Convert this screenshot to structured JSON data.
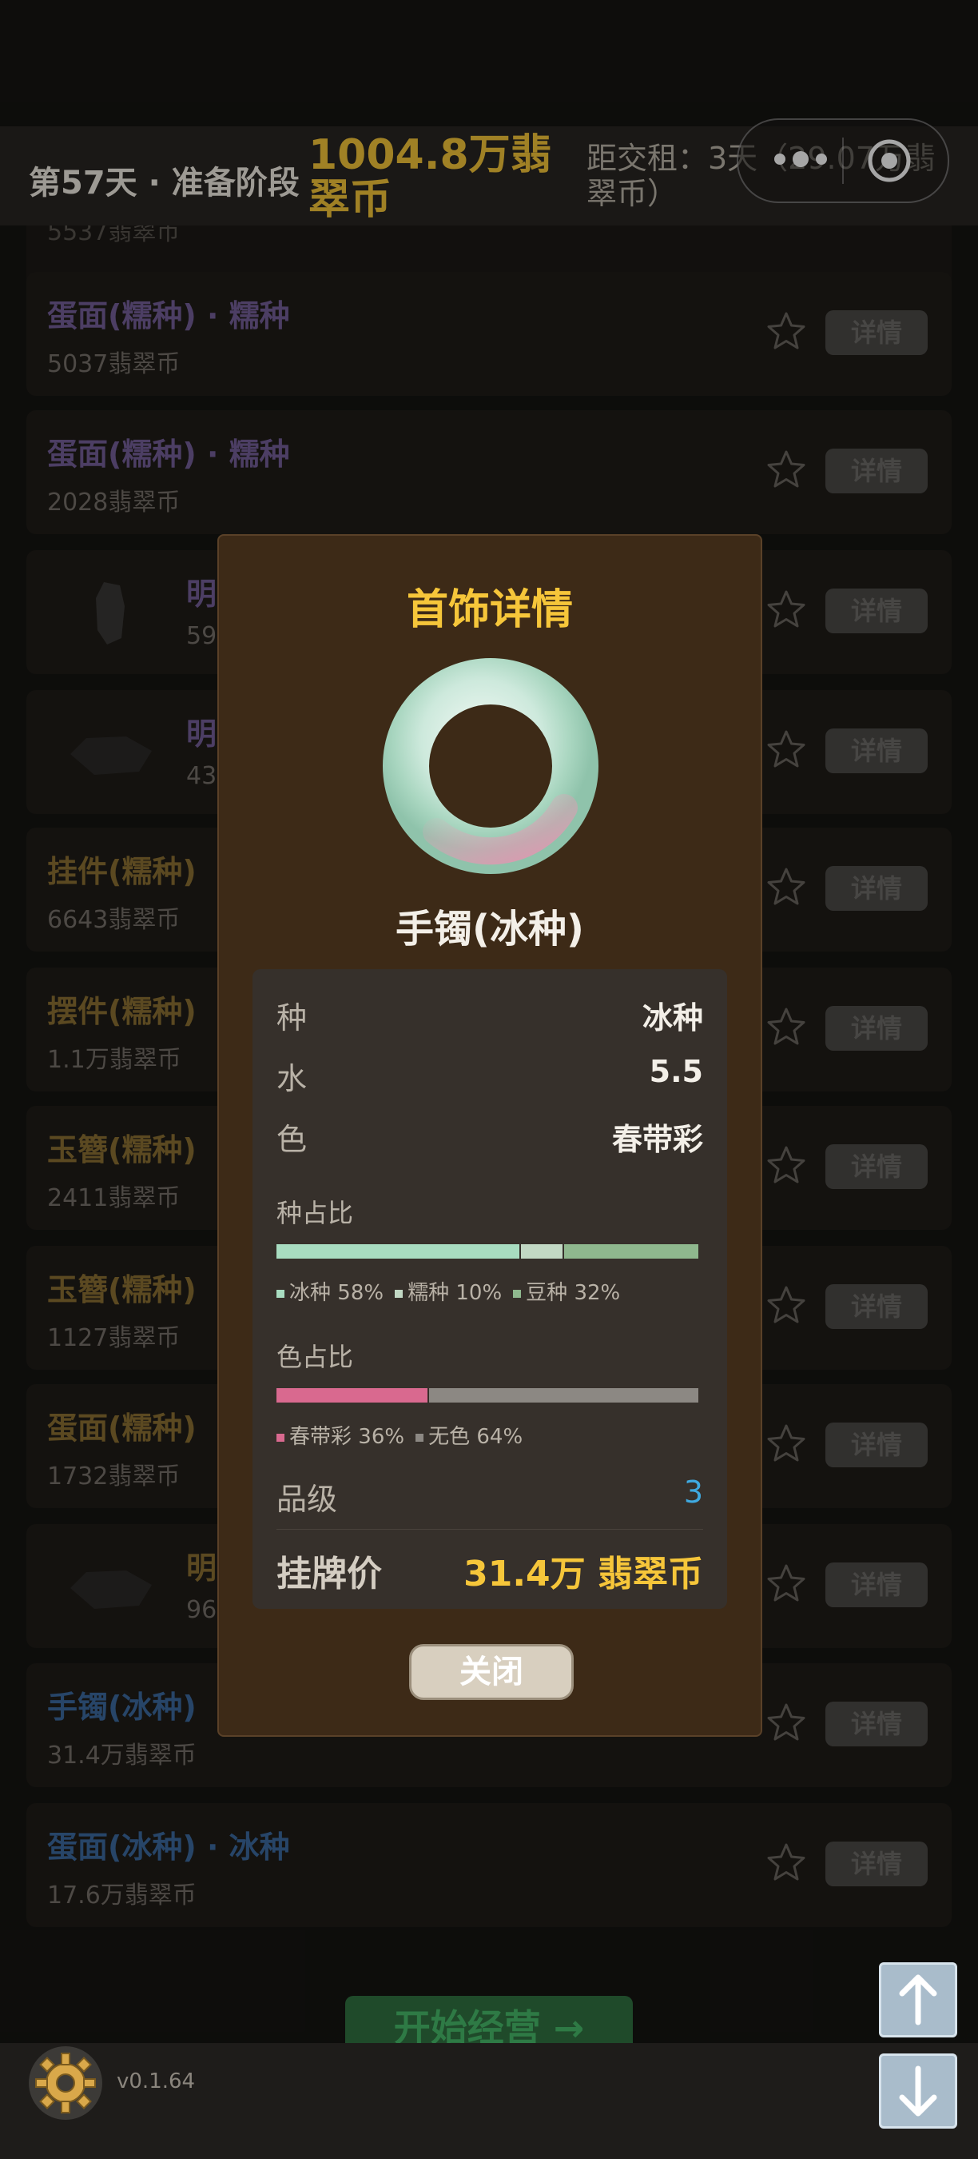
{
  "header": {
    "day_stage": "第57天 · 准备阶段",
    "money": "1004.8万翡翠币",
    "rent_info": "距交租：3天（29.07万翡翠币）"
  },
  "list": {
    "items": [
      {
        "name": "蛋面(糯种) · 糯种",
        "price": "5037翡翠币",
        "color": "purple",
        "detail_label": "详情"
      },
      {
        "name": "蛋面(糯种) · 糯种",
        "price": "2028翡翠币",
        "color": "purple",
        "detail_label": "详情"
      },
      {
        "name": "明",
        "price": "59",
        "color": "purple",
        "detail_label": "详情"
      },
      {
        "name": "明",
        "price": "43",
        "color": "purple",
        "detail_label": "详情"
      },
      {
        "name": "挂件(糯种)",
        "price": "6643翡翠币",
        "color": "gold",
        "detail_label": "详情"
      },
      {
        "name": "摆件(糯种)",
        "price": "1.1万翡翠币",
        "color": "gold",
        "detail_label": "详情"
      },
      {
        "name": "玉簪(糯种)",
        "price": "2411翡翠币",
        "color": "gold",
        "detail_label": "详情"
      },
      {
        "name": "玉簪(糯种)",
        "price": "1127翡翠币",
        "color": "gold",
        "detail_label": "详情"
      },
      {
        "name": "蛋面(糯种)",
        "price": "1732翡翠币",
        "color": "gold",
        "detail_label": "详情"
      },
      {
        "name": "明",
        "price": "96",
        "color": "gold",
        "detail_label": "详情"
      },
      {
        "name": "手镯(冰种)",
        "price": "31.4万翡翠币",
        "color": "blue",
        "detail_label": "详情"
      },
      {
        "name": "蛋面(冰种) · 冰种",
        "price": "17.6万翡翠币",
        "color": "blue",
        "detail_label": "详情"
      }
    ]
  },
  "modal": {
    "title": "首饰详情",
    "item_name": "手镯(冰种)",
    "rows": {
      "zhong_label": "种",
      "zhong_value": "冰种",
      "shui_label": "水",
      "shui_value": "5.5",
      "se_label": "色",
      "se_value": "春带彩"
    },
    "zhong_ratio": {
      "title": "种占比",
      "segments": [
        {
          "name": "冰种",
          "percent": 58,
          "label": "58%",
          "color": "#a8dcc0"
        },
        {
          "name": "糯种",
          "percent": 10,
          "label": "10%",
          "color": "#c2d8c4"
        },
        {
          "name": "豆种",
          "percent": 32,
          "label": "32%",
          "color": "#8fb88e"
        }
      ]
    },
    "se_ratio": {
      "title": "色占比",
      "segments": [
        {
          "name": "春带彩",
          "percent": 36,
          "label": "36%",
          "color": "#d9698f"
        },
        {
          "name": "无色",
          "percent": 64,
          "label": "64%",
          "color": "#8c8883"
        }
      ]
    },
    "grade_label": "品级",
    "grade_value": "3",
    "price_label": "挂牌价",
    "price_value": "31.4万 翡翠币",
    "close_label": "关闭"
  },
  "footer": {
    "start_label": "开始经营 →",
    "version": "v0.1.64"
  }
}
